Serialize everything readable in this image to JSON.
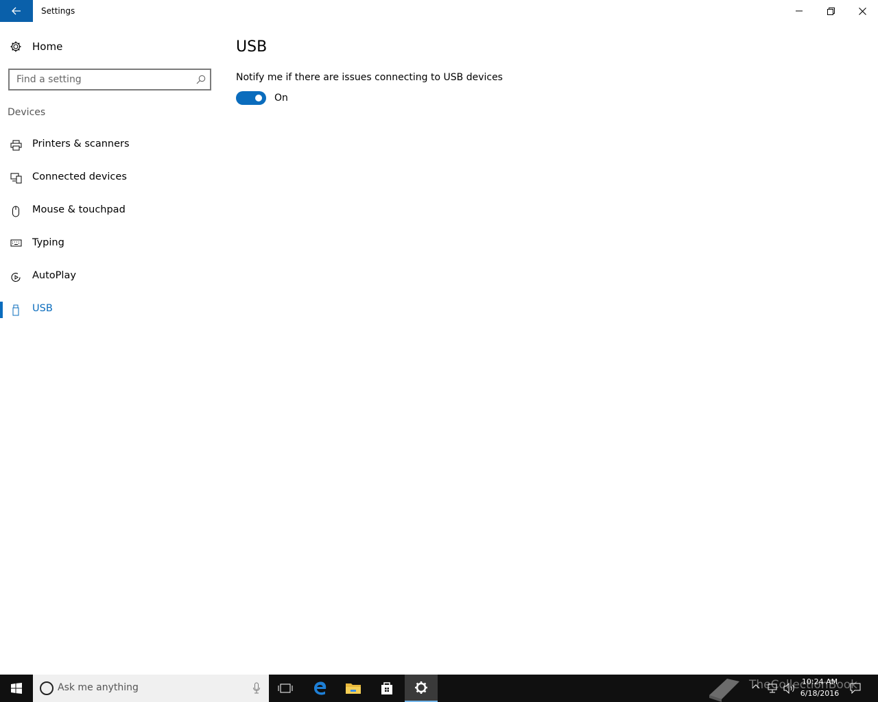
{
  "window": {
    "title": "Settings"
  },
  "sidebar": {
    "home_label": "Home",
    "search_placeholder": "Find a setting",
    "section": "Devices",
    "items": [
      {
        "label": "Printers & scanners",
        "icon": "printer-icon"
      },
      {
        "label": "Connected devices",
        "icon": "connected-devices-icon"
      },
      {
        "label": "Mouse & touchpad",
        "icon": "mouse-icon"
      },
      {
        "label": "Typing",
        "icon": "keyboard-icon"
      },
      {
        "label": "AutoPlay",
        "icon": "autoplay-icon"
      },
      {
        "label": "USB",
        "icon": "usb-icon",
        "active": true
      }
    ]
  },
  "content": {
    "title": "USB",
    "setting_label": "Notify me if there are issues connecting to USB devices",
    "toggle_state": "On",
    "toggle_on": true
  },
  "taskbar": {
    "search_placeholder": "Ask me anything",
    "time": "10:24 AM",
    "date": "6/18/2016",
    "watermark": "TheCollectionBook"
  },
  "colors": {
    "accent": "#0a6cbd",
    "titlebar_back": "#0a60aa",
    "taskbar": "#101010"
  }
}
